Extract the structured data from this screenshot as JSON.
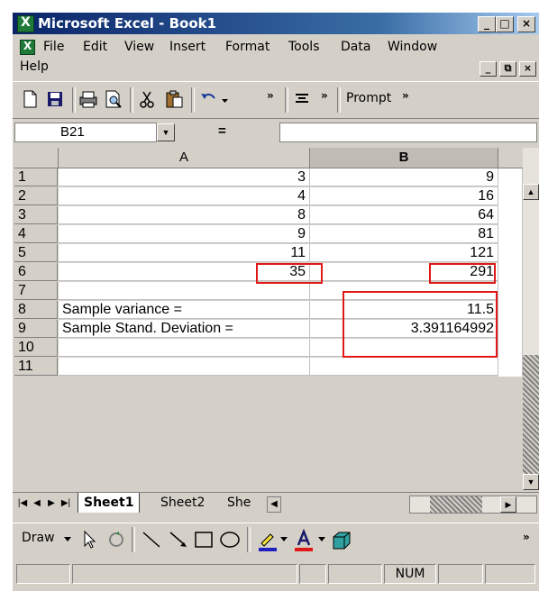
{
  "window": {
    "title": "Microsoft Excel - Book1",
    "controls": {
      "minimize": "_",
      "maximize": "□",
      "close": "×"
    }
  },
  "menu": {
    "items": [
      "File",
      "Edit",
      "View",
      "Insert",
      "Format",
      "Tools",
      "Data",
      "Window",
      "Help"
    ],
    "mdi_controls": {
      "minimize": "_",
      "restore": "⧉",
      "close": "×"
    }
  },
  "toolbar": {
    "prompt_label": "Prompt",
    "chevron": "»"
  },
  "formula_bar": {
    "name_box": "B21",
    "equals": "=",
    "formula": ""
  },
  "grid": {
    "columns": [
      "A",
      "B"
    ],
    "active_column": "B",
    "row_headers": [
      "1",
      "2",
      "3",
      "4",
      "5",
      "6",
      "7",
      "8",
      "9",
      "10",
      "11"
    ],
    "rows": [
      {
        "a": "3",
        "b": "9"
      },
      {
        "a": "4",
        "b": "16"
      },
      {
        "a": "8",
        "b": "64"
      },
      {
        "a": "9",
        "b": "81"
      },
      {
        "a": "11",
        "b": "121"
      },
      {
        "a": "35",
        "b": "291"
      },
      {
        "a": "",
        "b": ""
      },
      {
        "a": "Sample variance =",
        "b": "11.5"
      },
      {
        "a": "Sample Stand. Deviation =",
        "b": "3.391164992"
      },
      {
        "a": "",
        "b": ""
      },
      {
        "a": "",
        "b": ""
      }
    ]
  },
  "sheets": {
    "tabs": [
      "Sheet1",
      "Sheet2",
      "She"
    ],
    "active": "Sheet1"
  },
  "draw_toolbar": {
    "draw_label": "Draw"
  },
  "status_bar": {
    "num_indicator": "NUM"
  },
  "colors": {
    "highlight_border": "#e01818",
    "title_bar_start": "#0a246a",
    "face": "#d4d0c8"
  }
}
